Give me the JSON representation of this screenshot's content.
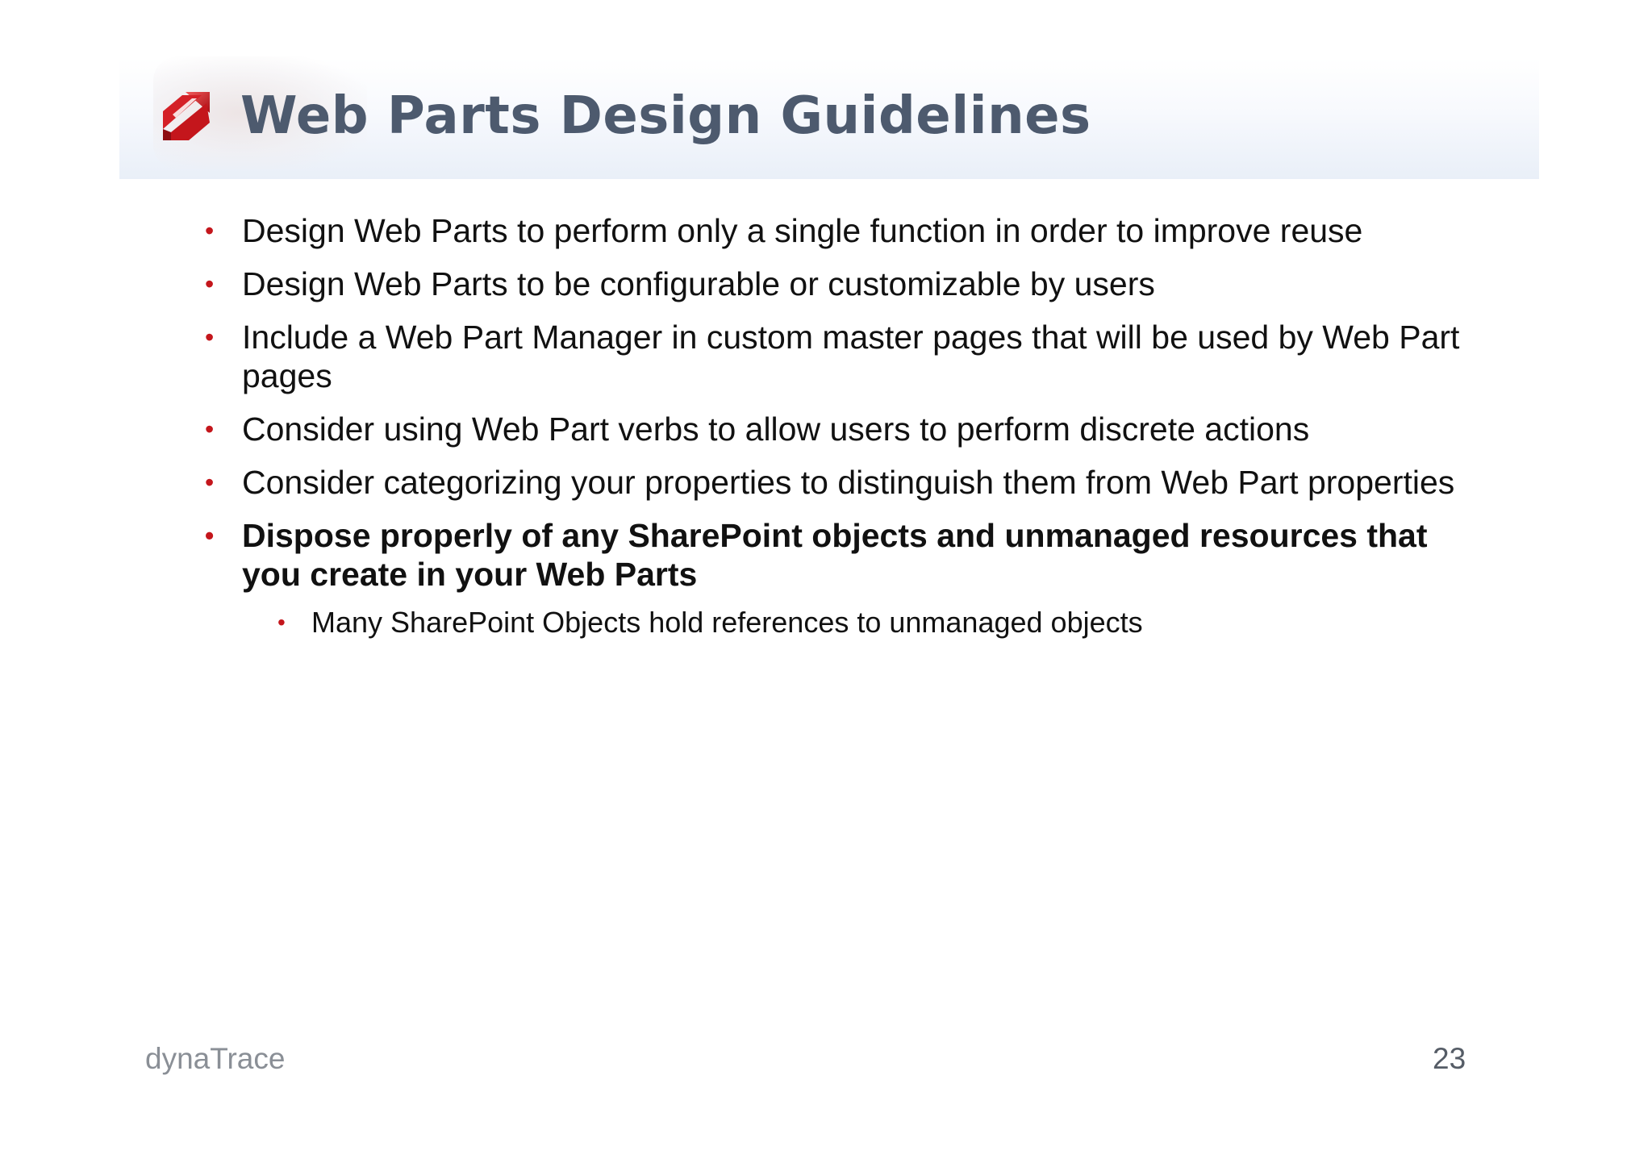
{
  "slide": {
    "title": "Web Parts Design Guidelines",
    "logo_icon": "dynatrace-logo-icon",
    "bullets": [
      {
        "text": "Design Web Parts to perform only a single function in order to improve reuse",
        "bold": false
      },
      {
        "text": "Design Web Parts to be configurable or customizable by users",
        "bold": false
      },
      {
        "text": "Include a Web Part Manager in custom master pages that will be used by Web Part pages",
        "bold": false
      },
      {
        "text": "Consider using Web Part verbs to allow users to perform discrete actions",
        "bold": false
      },
      {
        "text": "Consider categorizing your properties to distinguish them from Web Part properties",
        "bold": false
      },
      {
        "text": "Dispose properly of any SharePoint objects and unmanaged resources that you create in your Web Parts",
        "bold": true,
        "sub_bullets": [
          "Many SharePoint Objects hold references to unmanaged objects"
        ]
      }
    ],
    "bullet_marker": "•",
    "footer_brand": "dynaTrace",
    "page_number": "23",
    "colors": {
      "title": "#4d5a6e",
      "bullet_marker": "#c4161c",
      "body_text": "#111111",
      "logo_red": "#c4161c"
    }
  }
}
